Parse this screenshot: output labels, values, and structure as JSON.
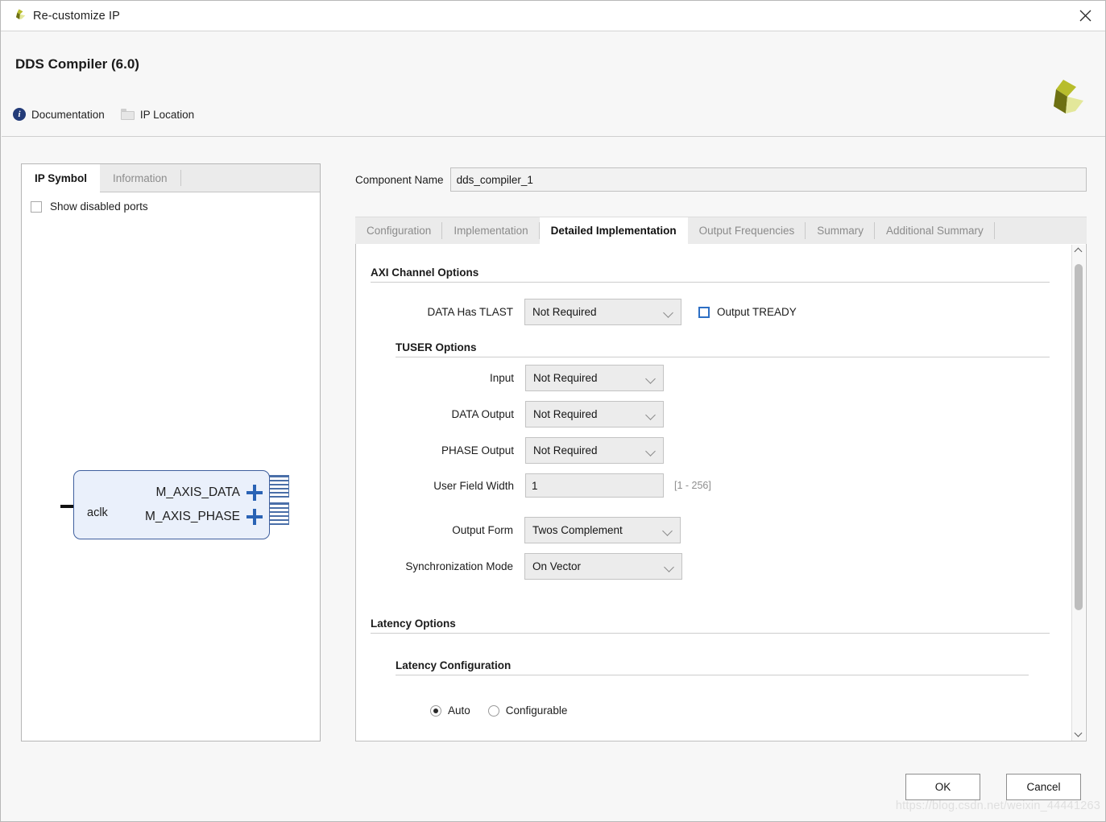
{
  "window": {
    "title": "Re-customize IP",
    "close_icon": "close-icon",
    "app_icon": "xilinx-logo-icon"
  },
  "header": {
    "title": "DDS Compiler (6.0)",
    "links": [
      {
        "label": "Documentation",
        "icon": "info-icon"
      },
      {
        "label": "IP Location",
        "icon": "folder-icon"
      }
    ],
    "brand_logo": "xilinx-pinwheel-logo",
    "brand_colors": {
      "dark": "#6d7012",
      "mid": "#b8bd2c",
      "light": "#e3e79a"
    }
  },
  "left_panel": {
    "tabs": [
      {
        "label": "IP Symbol",
        "active": true
      },
      {
        "label": "Information",
        "active": false
      }
    ],
    "show_disabled_ports": {
      "label": "Show disabled ports",
      "checked": false
    },
    "symbol": {
      "clock_port": "aclk",
      "output_ports": [
        "M_AXIS_DATA",
        "M_AXIS_PHASE"
      ],
      "box_fill": "#eaf0fb",
      "box_border": "#3f5f9e",
      "plus_color": "#2a63b5"
    }
  },
  "main": {
    "component_name": {
      "label": "Component Name",
      "value": "dds_compiler_1"
    },
    "tabs": [
      {
        "label": "Configuration",
        "active": false
      },
      {
        "label": "Implementation",
        "active": false
      },
      {
        "label": "Detailed Implementation",
        "active": true
      },
      {
        "label": "Output Frequencies",
        "active": false
      },
      {
        "label": "Summary",
        "active": false
      },
      {
        "label": "Additional Summary",
        "active": false
      }
    ],
    "sections": {
      "axi_channel_options": {
        "title": "AXI Channel Options",
        "data_has_tlast": {
          "label": "DATA Has TLAST",
          "value": "Not Required"
        },
        "output_tready": {
          "label": "Output TREADY",
          "checked": false
        },
        "tuser_options": {
          "title": "TUSER Options",
          "input": {
            "label": "Input",
            "value": "Not Required"
          },
          "data_output": {
            "label": "DATA Output",
            "value": "Not Required"
          },
          "phase_output": {
            "label": "PHASE Output",
            "value": "Not Required"
          },
          "user_field_width": {
            "label": "User Field Width",
            "value": "1",
            "range": "[1 - 256]"
          }
        },
        "output_form": {
          "label": "Output Form",
          "value": "Twos Complement"
        },
        "synchronization_mode": {
          "label": "Synchronization Mode",
          "value": "On Vector"
        }
      },
      "latency_options": {
        "title": "Latency Options",
        "latency_configuration": {
          "title": "Latency Configuration",
          "options": [
            {
              "label": "Auto",
              "selected": true
            },
            {
              "label": "Configurable",
              "selected": false
            }
          ]
        }
      }
    }
  },
  "footer": {
    "ok_label": "OK",
    "cancel_label": "Cancel"
  },
  "watermark": "https://blog.csdn.net/weixin_44441263"
}
